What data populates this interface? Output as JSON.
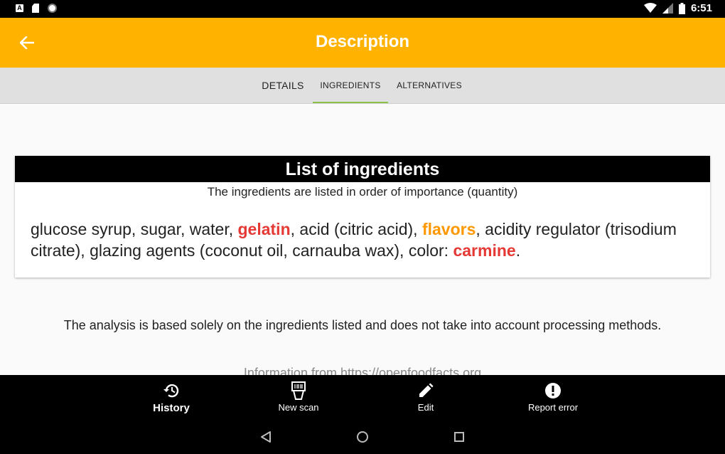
{
  "status_bar": {
    "time": "6:51",
    "notification_a": "A"
  },
  "app_bar": {
    "title": "Description"
  },
  "tabs": [
    {
      "label": "DETAILS"
    },
    {
      "label": "INGREDIENTS"
    },
    {
      "label": "ALTERNATIVES"
    }
  ],
  "card": {
    "header": "List of ingredients",
    "subtitle": "The ingredients are listed in order of importance (quantity)",
    "ingredients": [
      {
        "text": "glucose syrup, sugar, water, ",
        "style": "normal"
      },
      {
        "text": "gelatin",
        "style": "allergen"
      },
      {
        "text": ", acid (citric acid), ",
        "style": "normal"
      },
      {
        "text": "flavors",
        "style": "additive"
      },
      {
        "text": ", acidity regulator (trisodium citrate), glazing agents (coconut oil, carnauba wax), color: ",
        "style": "normal"
      },
      {
        "text": "carmine",
        "style": "allergen"
      },
      {
        "text": ".",
        "style": "normal"
      }
    ]
  },
  "analysis_note": "The analysis is based solely on the ingredients listed and does not take into account processing methods.",
  "source_note": "Information from https://openfoodfacts.org",
  "bottom_nav": {
    "history": "History",
    "new_scan": "New scan",
    "edit": "Edit",
    "report_error": "Report error"
  },
  "colors": {
    "app_bar": "#ffb300",
    "tab_indicator": "#8bc34a",
    "allergen": "#e53935",
    "additive": "#ff9800"
  },
  "icons": [
    "back-arrow-icon",
    "history-icon",
    "barcode-scan-icon",
    "pencil-icon",
    "alert-circle-icon",
    "wifi-icon",
    "signal-icon",
    "battery-icon",
    "nav-back-icon",
    "nav-home-icon",
    "nav-recents-icon"
  ]
}
